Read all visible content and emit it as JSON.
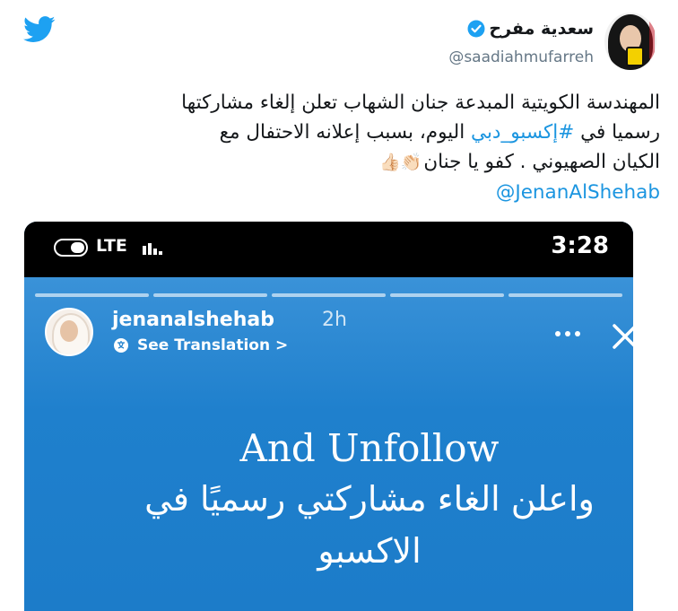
{
  "tweet": {
    "author_name": "سعدية مفرح",
    "author_handle": "@saadiahmufarreh",
    "text": {
      "line1": "المهندسة الكويتية المبدعة جنان الشهاب تعلن إلغاء مشاركتها",
      "line2_pre": "رسميا في ",
      "line2_hashtag": "#إكسبو_دبي",
      "line2_post": " اليوم، بسبب إعلانه الاحتفال مع",
      "line3": "الكيان الصهيوني . كفو يا جنان",
      "line3_emoji": "👏🏻👍🏻",
      "mention": "@JenanAlShehab"
    },
    "colors": {
      "link": "#1b95e0",
      "text": "#14171a",
      "muted": "#657786",
      "twitter_blue": "#1da1f2"
    }
  },
  "media": {
    "status_bar": {
      "network": "LTE",
      "time": "3:28"
    },
    "story": {
      "username": "jenanalshehab",
      "age": "2h",
      "see_translation": "See Translation >",
      "line1": "And Unfollow",
      "line2": "واعلن الغاء مشاركتي رسميًا في",
      "line3": "الاكسبو"
    },
    "background_color": "#1f80cd"
  },
  "icons": [
    "twitter-bird-icon",
    "verified-icon",
    "toggle-icon",
    "signal-icon",
    "translate-icon",
    "more-icon",
    "close-icon"
  ]
}
